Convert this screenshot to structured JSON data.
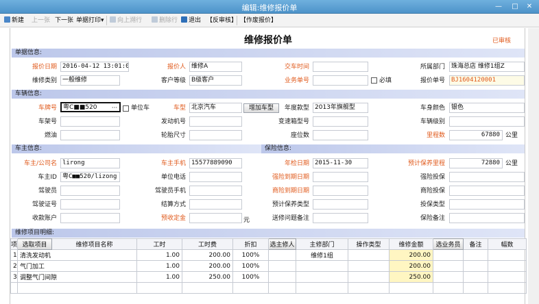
{
  "window": {
    "title": "编辑:维修报价单",
    "minimize_label": "—",
    "maximize_label": "□",
    "close_label": "✕"
  },
  "toolbar": {
    "new": "新建",
    "prev": "上一张",
    "next": "下一张",
    "print": "单据打印",
    "upstream": "向上溯行",
    "delete_row": "删除行",
    "exit": "退出",
    "unapprove": "【反审核】",
    "void": "【作废报价】"
  },
  "form": {
    "title": "维修报价单",
    "status": "已审核"
  },
  "sections": {
    "document": "单据信息:",
    "vehicle": "车辆信息:",
    "owner": "车主信息:",
    "insurance": "保险信息:",
    "items": "维修项目明细:"
  },
  "doc": {
    "quote_date_label": "报价日期",
    "quote_date": "2016-04-12 13:01:04",
    "quoter_label": "报价人",
    "quoter": "维修A",
    "delivery_time_label": "交车时间",
    "delivery_time": "",
    "dept_label": "所属部门",
    "dept": "珠海总店    维修1组Z",
    "repair_type_label": "维修类别",
    "repair_type": "一般维修",
    "customer_level_label": "客户等级",
    "customer_level": "B级客户",
    "business_no_label": "业务单号",
    "business_no": "",
    "required_label": "必填",
    "quote_no_label": "报价单号",
    "quote_no": "BJ1604120001"
  },
  "vehicle": {
    "plate_label": "车牌号",
    "plate": "粤C■■520",
    "plate_btn": "···",
    "unit_car_label": "单位车",
    "brand_label": "车型",
    "brand": "北京汽车",
    "add_model_btn": "增加车型",
    "year_label": "年度款型",
    "year": "2013年旗舰型",
    "color_label": "车身颜色",
    "color": "银色",
    "frame_label": "车架号",
    "frame": "",
    "engine_label": "发动机号",
    "engine": "",
    "gearbox_label": "变速箱型号",
    "gearbox": "",
    "level_label": "车辆级别",
    "level": "",
    "fuel_label": "燃油",
    "fuel": "",
    "tire_label": "轮胎尺寸",
    "tire": "",
    "seats_label": "座位数",
    "seats": "",
    "mileage_label": "里程数",
    "mileage": "67880",
    "mileage_unit": "公里"
  },
  "owner": {
    "company_label": "车主/公司名",
    "company": "lirong",
    "phone_label": "车主手机",
    "phone": "15577889090",
    "owner_id_label": "车主ID",
    "owner_id": "粤C■■520/lizong",
    "unit_phone_label": "单位电话",
    "unit_phone": "",
    "driver_label": "驾驶员",
    "driver": "",
    "driver_phone_label": "驾驶员手机",
    "driver_phone": "",
    "license_label": "驾驶证号",
    "license": "",
    "settle_label": "结算方式",
    "settle": "",
    "receivable_label": "收款账户",
    "receivable": "",
    "prepay_label": "预收定金",
    "prepay": "",
    "prepay_unit": "元"
  },
  "insurance": {
    "annual_label": "年检日期",
    "annual": "2015-11-30",
    "maint_mileage_label": "预计保养里程",
    "maint_mileage": "72880",
    "maint_unit": "公里",
    "expire_label": "强险到期日期",
    "expire": "",
    "compulsory_label": "强险投保",
    "compulsory": "",
    "commercial_expire_label": "商险到期日期",
    "commercial_expire": "",
    "commercial_label": "商险投保",
    "commercial": "",
    "maint_type_label": "预计保养类型",
    "maint_type": "",
    "ins_type_label": "投保类型",
    "ins_type": "",
    "remark_label": "送修问题备注",
    "remark": "",
    "ins_remark_label": "保险备注",
    "ins_remark": ""
  },
  "items": {
    "headers": [
      "项",
      "选取项目",
      "维修项目名称",
      "工时",
      "工时费",
      "折扣",
      "选主修人",
      "主修部门",
      "操作类型",
      "维修金额",
      "选业务员",
      "备注",
      "幅数"
    ],
    "rows": [
      {
        "no": "1",
        "name": "清洗发动机",
        "hours": "1.00",
        "fee": "200.00",
        "discount": "100%",
        "dept": "维修1组",
        "op": "",
        "amount": "200.00"
      },
      {
        "no": "2",
        "name": "气门加工",
        "hours": "1.00",
        "fee": "200.00",
        "discount": "100%",
        "dept": "",
        "op": "",
        "amount": "200.00"
      },
      {
        "no": "3",
        "name": "调整气门间隙",
        "hours": "1.00",
        "fee": "250.00",
        "discount": "100%",
        "dept": "",
        "op": "",
        "amount": "250.00"
      }
    ]
  }
}
